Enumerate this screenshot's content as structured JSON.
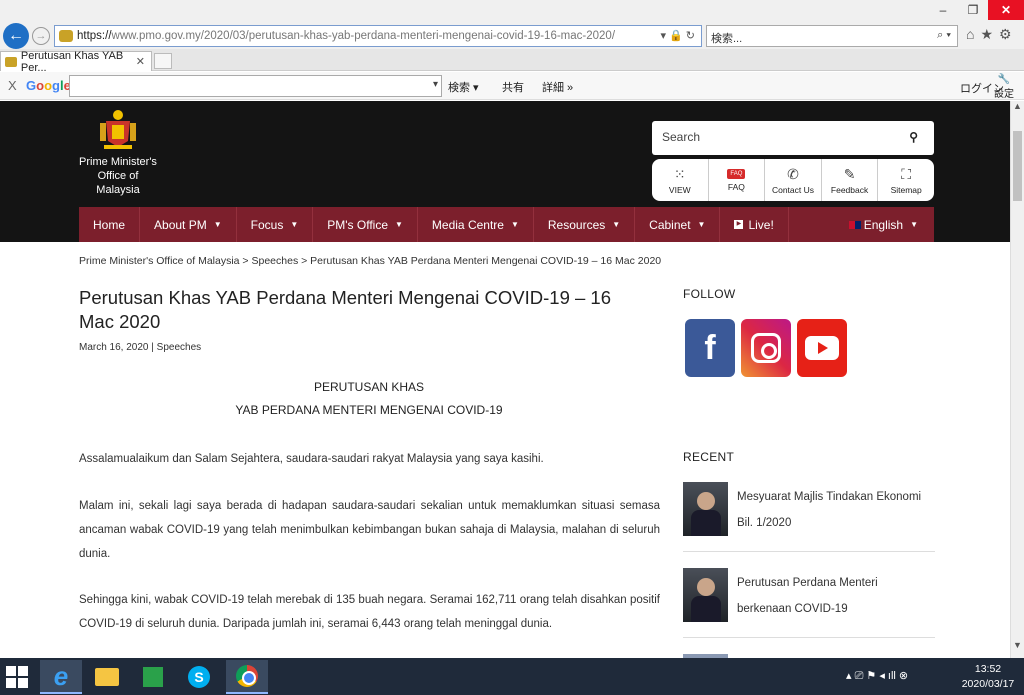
{
  "browser": {
    "window_controls": {
      "minimize": "–",
      "restore": "❐",
      "close": "✕"
    },
    "back_glyph": "←",
    "forward_glyph": "→",
    "url_https": "https://",
    "url_rest": "www.pmo.gov.my/2020/03/perutusan-khas-yab-perdana-menteri-mengenai-covid-19-16-mac-2020/",
    "url_tail": "▾ 🔒 ↻",
    "search_placeholder": "検索...",
    "search_glyph": "⌕ ▾",
    "icons": {
      "home": "⌂",
      "favorites": "★",
      "tools": "⚙"
    },
    "tab_title": "Perutusan Khas YAB Per...",
    "tab_close": "✕"
  },
  "google_bar": {
    "close": "X",
    "logo": [
      "G",
      "o",
      "o",
      "g",
      "l",
      "e"
    ],
    "caret": "▾",
    "search_label": "検索 ▾",
    "share_label": "共有",
    "more_label": "詳細 »",
    "login_label": "ログイン",
    "settings_label": "設定",
    "settings_glyph": "🔧"
  },
  "site": {
    "org_name_line1": "Prime Minister's",
    "org_name_line2": "Office of",
    "org_name_line3": "Malaysia",
    "search_placeholder": "Search",
    "search_glyph": "⚲",
    "quick_links": [
      {
        "label": "VIEW",
        "icon": "⁙"
      },
      {
        "label": "FAQ",
        "icon": "FAQ"
      },
      {
        "label": "Contact Us",
        "icon": "✆"
      },
      {
        "label": "Feedback",
        "icon": "✎"
      },
      {
        "label": "Sitemap",
        "icon": "⛶"
      }
    ],
    "nav": [
      {
        "label": "Home",
        "caret": ""
      },
      {
        "label": "About PM",
        "caret": "▼"
      },
      {
        "label": "Focus",
        "caret": "▼"
      },
      {
        "label": "PM's Office",
        "caret": "▼"
      },
      {
        "label": "Media Centre",
        "caret": "▼"
      },
      {
        "label": "Resources",
        "caret": "▼"
      },
      {
        "label": "Cabinet",
        "caret": "▼"
      },
      {
        "label": "Live!",
        "caret": ""
      }
    ],
    "live_glyph": "▶",
    "language": "English",
    "language_caret": "▼"
  },
  "article": {
    "breadcrumb": "Prime Minister's Office of Malaysia > Speeches > Perutusan Khas YAB Perdana Menteri Mengenai COVID-19 – 16 Mac 2020",
    "title": "Perutusan Khas YAB Perdana Menteri Mengenai COVID-19 – 16 Mac 2020",
    "date": "March 16, 2020",
    "separator": "|",
    "category": "Speeches",
    "subheading1": "PERUTUSAN KHAS",
    "subheading2": "YAB PERDANA MENTERI MENGENAI COVID-19",
    "paragraphs": [
      "Assalamualaikum dan Salam Sejahtera, saudara-saudari rakyat Malaysia yang saya kasihi.",
      "Malam ini, sekali lagi saya berada di hadapan saudara-saudari sekalian untuk memaklumkan situasi semasa ancaman wabak COVID-19 yang telah menimbulkan kebimbangan bukan sahaja di Malaysia, malahan di seluruh dunia.",
      "Sehingga kini, wabak COVID-19 telah merebak di 135 buah negara. Seramai 162,711 orang telah disahkan positif COVID-19 di seluruh dunia. Daripada jumlah ini, seramai 6,443 orang telah meninggal dunia."
    ]
  },
  "sidebar": {
    "follow_heading": "FOLLOW",
    "facebook_glyph": "f",
    "recent_heading": "RECENT",
    "recent": [
      {
        "title": "Mesyuarat Majlis Tindakan Ekonomi Bil. 1/2020"
      },
      {
        "title": "Perutusan Perdana Menteri berkenaan COVID-19"
      }
    ]
  },
  "scrollbar": {
    "up": "▲",
    "down": "▼"
  },
  "taskbar": {
    "ie_glyph": "e",
    "skype_glyph": "S",
    "tray": "▴ ⎚ ⚑ ◂ ıll ⊗",
    "time": "13:52",
    "date": "2020/03/17"
  }
}
